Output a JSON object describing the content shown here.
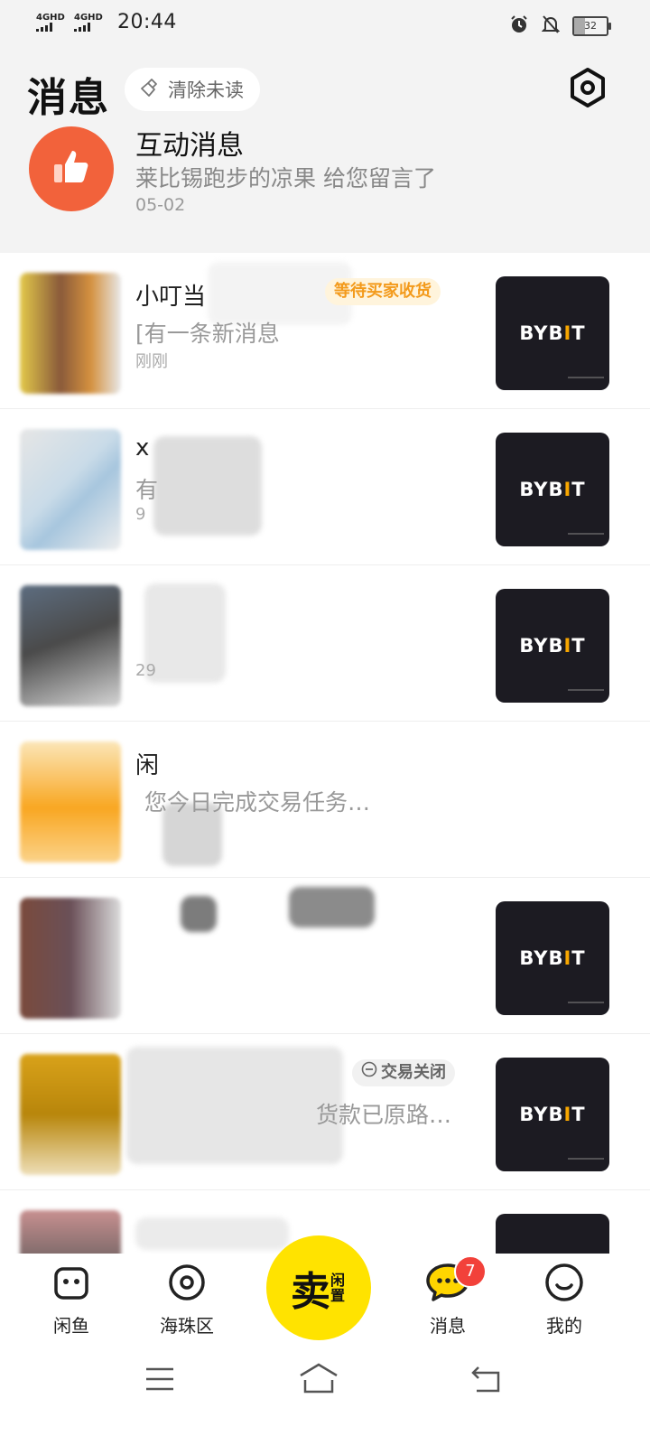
{
  "status_bar": {
    "signal_1": "4GHD",
    "signal_2": "4GHD",
    "time": "20:44",
    "battery": "32"
  },
  "header": {
    "title": "消息",
    "clear_unread": "清除未读"
  },
  "interaction": {
    "title": "互动消息",
    "subtitle": "莱比锡跑步的凉果 给您留言了",
    "date": "05-02"
  },
  "conversations": [
    {
      "name": "小叮当",
      "preview": "[有一条新消息",
      "time": "刚刚",
      "status": "等待买家收货",
      "thumb_logo": "BYBIT"
    },
    {
      "name": "x",
      "preview": "有",
      "time": "9",
      "thumb_logo": "BYBIT"
    },
    {
      "name": "",
      "preview": "",
      "time": "29",
      "thumb_logo": "BYBIT"
    },
    {
      "name": "闲",
      "preview": "您今日完成交易任务…",
      "time": ""
    },
    {
      "name": "",
      "preview": "",
      "time": "",
      "thumb_logo": "BYBIT"
    },
    {
      "name": "",
      "preview": "货款已原路…",
      "time": "",
      "status": "交易关闭",
      "thumb_logo": "BYBIT"
    },
    {
      "name": "",
      "preview": "",
      "time": ""
    }
  ],
  "tabbar": {
    "home": "闲鱼",
    "nearby": "海珠区",
    "sell": "卖",
    "sell_sub": "闲置",
    "messages": "消息",
    "messages_badge": "7",
    "me": "我的"
  },
  "colors": {
    "accent": "#ffe300",
    "status_orange": "#f39a1b",
    "like_red": "#f2623b",
    "badge_red": "#f2413a"
  }
}
